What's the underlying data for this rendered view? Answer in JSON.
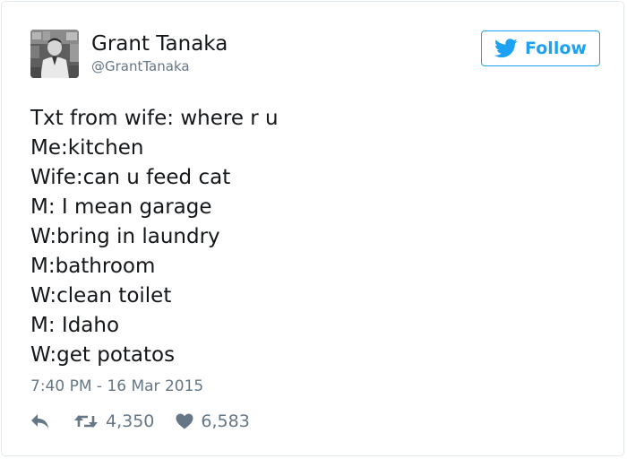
{
  "user": {
    "name": "Grant Tanaka",
    "handle": "@GrantTanaka"
  },
  "follow_button": {
    "label": "Follow",
    "icon": "twitter-bird-icon",
    "color": "#1da1f2"
  },
  "tweet": {
    "lines": [
      "Txt from wife: where r u",
      "Me:kitchen",
      "Wife:can u feed cat",
      "M: I mean garage",
      "W:bring in laundry",
      "M:bathroom",
      "W:clean toilet",
      "M: Idaho",
      "W:get potatos"
    ],
    "timestamp": "7:40 PM - 16 Mar 2015"
  },
  "actions": {
    "reply_icon": "reply-icon",
    "retweet_icon": "retweet-icon",
    "retweet_count": "4,350",
    "like_icon": "heart-icon",
    "like_count": "6,583"
  },
  "colors": {
    "text": "#14171a",
    "secondary": "#657786",
    "border": "#e1e8ed"
  }
}
